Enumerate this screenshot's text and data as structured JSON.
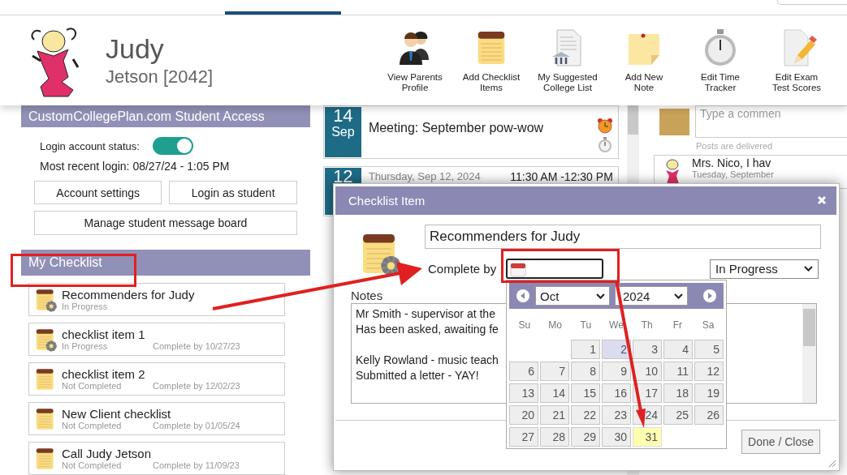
{
  "student": {
    "first_name": "Judy",
    "last_name": "Jetson [2042]"
  },
  "toolbar": [
    {
      "kind": "parents",
      "label": "View Parents\nProfile"
    },
    {
      "kind": "checklist",
      "label": "Add Checklist\nItems"
    },
    {
      "kind": "colleges",
      "label": "My Suggested\nCollege List"
    },
    {
      "kind": "note",
      "label": "Add New\nNote"
    },
    {
      "kind": "timer",
      "label": "Edit Time\nTracker"
    },
    {
      "kind": "scores",
      "label": "Edit Exam\nTest Scores"
    }
  ],
  "student_access": {
    "title": "CustomCollegePlan.com Student Access",
    "status_label": "Login account status:",
    "login_enabled": true,
    "last_login": "Most recent login: 08/27/24 - 1:05 PM",
    "buttons": [
      "Account settings",
      "Login as student"
    ],
    "wide_button": "Manage student message board"
  },
  "checklist": {
    "title": "My Checklist",
    "items": [
      {
        "kind": "in_progress",
        "title": "Recommenders for Judy",
        "status": "In Progress"
      },
      {
        "kind": "in_progress",
        "title": "checklist item 1",
        "status": "In Progress",
        "due": "Complete by 10/27/23"
      },
      {
        "kind": "not_completed",
        "title": "checklist item 2",
        "status": "Not Completed",
        "due": "Complete by 12/02/23"
      },
      {
        "kind": "not_completed",
        "title": "New Client checklist",
        "status": "Not Completed",
        "due": "Complete by 01/05/24"
      },
      {
        "kind": "not_completed",
        "title": "Call Judy Jetson",
        "status": "Not Completed",
        "due": "Complete by 11/09/23"
      }
    ]
  },
  "events": [
    {
      "day": "14",
      "month": "Sep",
      "title": "Meeting: September pow-wow",
      "alarm": true,
      "timer": true
    },
    {
      "day": "12",
      "date": "Thursday, Sep 12, 2024",
      "time": "11:30 AM -12:30 PM"
    }
  ],
  "comments": {
    "placeholder": "Type a commen",
    "note": "Posts are delivered",
    "post": {
      "text": "Mrs. Nico, I hav",
      "date": "Tuesday, September"
    }
  },
  "dialog": {
    "title": "Checklist Item",
    "item_title": "Recommenders for Judy",
    "complete_by_label": "Complete by",
    "status": "In Progress",
    "notes_label": "Notes",
    "notes_lines": [
      "Mr Smith - supervisor at the",
      "Has been asked, awaiting fe",
      "Kelly Rowland - music teach",
      "Submitted a letter - YAY!"
    ],
    "done_button": "Done / Close"
  },
  "datepicker": {
    "month": "Oct",
    "year": "2024",
    "weekdays": [
      "Su",
      "Mo",
      "Tu",
      "We",
      "Th",
      "Fr",
      "Sa"
    ],
    "cells": [
      {
        "kind": "blank"
      },
      {
        "kind": "blank"
      },
      {
        "kind": "day",
        "day": "1",
        "selected": false,
        "hovered": false
      },
      {
        "kind": "day",
        "day": "2",
        "selected": false,
        "hovered": true
      },
      {
        "kind": "day",
        "day": "3",
        "selected": false,
        "hovered": false
      },
      {
        "kind": "day",
        "day": "4",
        "selected": false,
        "hovered": false
      },
      {
        "kind": "day",
        "day": "5",
        "selected": false,
        "hovered": false
      },
      {
        "kind": "day",
        "day": "6",
        "selected": false,
        "hovered": false
      },
      {
        "kind": "day",
        "day": "7",
        "selected": false,
        "hovered": false
      },
      {
        "kind": "day",
        "day": "8",
        "selected": false,
        "hovered": false
      },
      {
        "kind": "day",
        "day": "9",
        "selected": false,
        "hovered": false
      },
      {
        "kind": "day",
        "day": "10",
        "selected": false,
        "hovered": false
      },
      {
        "kind": "day",
        "day": "11",
        "selected": false,
        "hovered": false
      },
      {
        "kind": "day",
        "day": "12",
        "selected": false,
        "hovered": false
      },
      {
        "kind": "day",
        "day": "13",
        "selected": false,
        "hovered": false
      },
      {
        "kind": "day",
        "day": "14",
        "selected": false,
        "hovered": false
      },
      {
        "kind": "day",
        "day": "15",
        "selected": false,
        "hovered": false
      },
      {
        "kind": "day",
        "day": "16",
        "selected": false,
        "hovered": false
      },
      {
        "kind": "day",
        "day": "17",
        "selected": false,
        "hovered": false
      },
      {
        "kind": "day",
        "day": "18",
        "selected": false,
        "hovered": false
      },
      {
        "kind": "day",
        "day": "19",
        "selected": false,
        "hovered": false
      },
      {
        "kind": "day",
        "day": "20",
        "selected": false,
        "hovered": false
      },
      {
        "kind": "day",
        "day": "21",
        "selected": false,
        "hovered": false
      },
      {
        "kind": "day",
        "day": "22",
        "selected": false,
        "hovered": false
      },
      {
        "kind": "day",
        "day": "23",
        "selected": false,
        "hovered": false
      },
      {
        "kind": "day",
        "day": "24",
        "selected": false,
        "hovered": false
      },
      {
        "kind": "day",
        "day": "25",
        "selected": false,
        "hovered": false
      },
      {
        "kind": "day",
        "day": "26",
        "selected": false,
        "hovered": false
      },
      {
        "kind": "day",
        "day": "27",
        "selected": false,
        "hovered": false
      },
      {
        "kind": "day",
        "day": "28",
        "selected": false,
        "hovered": false
      },
      {
        "kind": "day",
        "day": "29",
        "selected": false,
        "hovered": false
      },
      {
        "kind": "day",
        "day": "30",
        "selected": false,
        "hovered": false
      },
      {
        "kind": "day",
        "day": "31",
        "selected": true,
        "hovered": false
      }
    ]
  }
}
